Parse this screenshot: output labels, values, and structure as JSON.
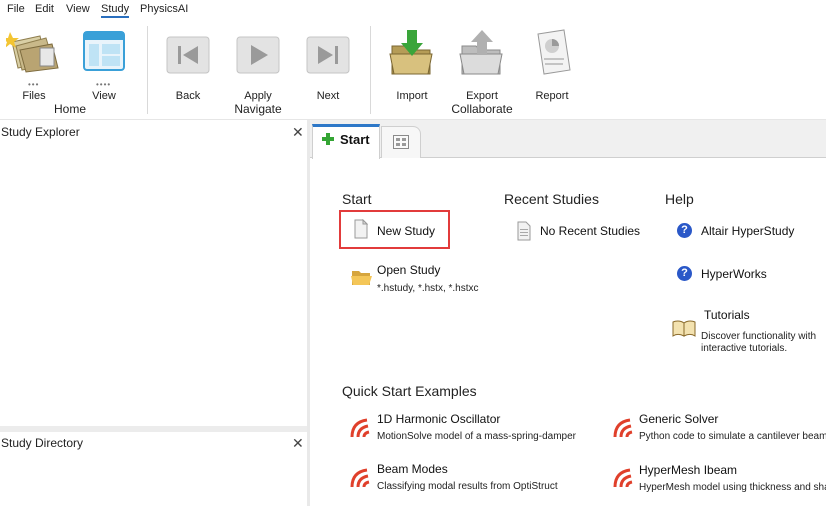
{
  "menu": [
    "File",
    "Edit",
    "View",
    "Study",
    "PhysicsAI"
  ],
  "ribbon": {
    "files_label": "Files",
    "view_label": "View",
    "home_group": "Home",
    "back_label": "Back",
    "apply_label": "Apply",
    "next_label": "Next",
    "navigate_group": "Navigate",
    "import_label": "Import",
    "export_label": "Export",
    "report_label": "Report",
    "collaborate_group": "Collaborate"
  },
  "panels": {
    "explorer_title": "Study Explorer",
    "directory_title": "Study Directory",
    "close_glyph": "✕"
  },
  "tabs": {
    "start_label": "Start"
  },
  "start": {
    "heading": "Start",
    "new_study": "New Study",
    "open_study": "Open Study",
    "open_study_ext": "*.hstudy, *.hstx, *.hstxc"
  },
  "recent": {
    "heading": "Recent Studies",
    "empty": "No Recent Studies"
  },
  "help": {
    "heading": "Help",
    "item1": "Altair HyperStudy",
    "item2": "HyperWorks",
    "tutorials": "Tutorials",
    "tutorials_desc1": "Discover functionality with",
    "tutorials_desc2": "interactive tutorials."
  },
  "quick": {
    "heading": "Quick Start Examples",
    "ex1_title": "1D Harmonic Oscillator",
    "ex1_desc": "MotionSolve model of a mass-spring-damper",
    "ex2_title": "Generic Solver",
    "ex2_desc": "Python code to simulate a cantilever beam",
    "ex3_title": "Beam Modes",
    "ex3_desc": "Classifying modal results from OptiStruct",
    "ex4_title": "HyperMesh Ibeam",
    "ex4_desc": "HyperMesh model using thickness and sha"
  },
  "colors": {
    "accent": "#2e78c8",
    "highlight": "#e23b3b",
    "help": "#2a58c8"
  }
}
